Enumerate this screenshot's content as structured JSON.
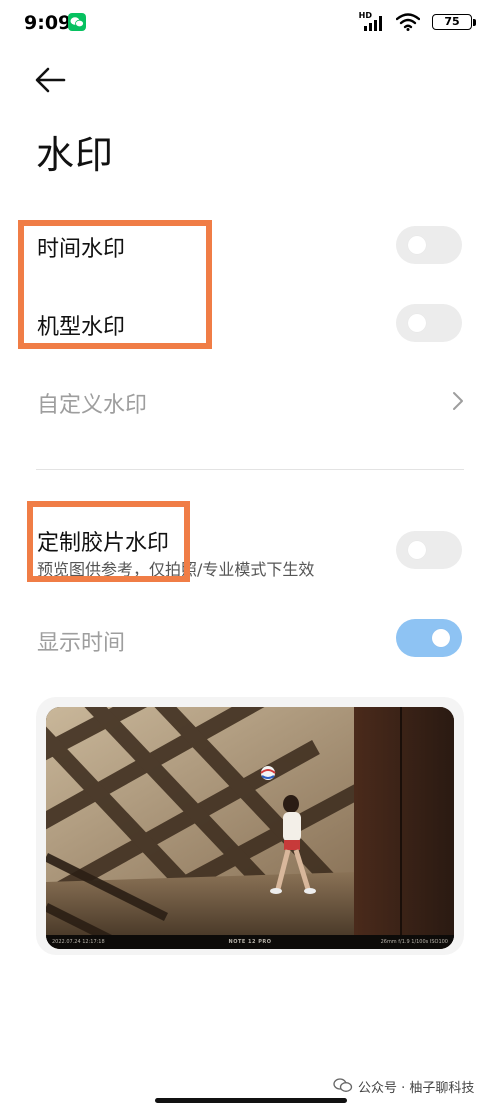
{
  "status_bar": {
    "time": "9:09",
    "network_badge": "HD",
    "battery": "75",
    "icons": [
      "wechat-icon",
      "signal-icon",
      "wifi-icon",
      "battery-icon"
    ]
  },
  "header": {
    "back_icon": "arrow-left-icon",
    "title": "水印"
  },
  "settings": {
    "time_watermark": {
      "label": "时间水印",
      "enabled": false
    },
    "model_watermark": {
      "label": "机型水印",
      "enabled": false
    },
    "custom_watermark": {
      "label": "自定义水印",
      "disabled": true,
      "icon": "chevron-right-icon"
    },
    "film_watermark": {
      "label": "定制胶片水印",
      "description": "预览图供参考，仅拍照/专业模式下生效",
      "enabled": false
    },
    "show_time": {
      "label": "显示时间",
      "enabled": true,
      "disabled": true
    }
  },
  "preview": {
    "date": "2022.07.24  12:17:18",
    "device": "NOTE 12 PRO",
    "specs": "26mm  f/1.9  1/100s  ISO100"
  },
  "footer": {
    "watermark_text": "公众号 · 柚子聊科技"
  },
  "colors": {
    "highlight": "#f07d46",
    "toggle_off": "#ececec",
    "toggle_on": "#8ec3f3",
    "wechat_green": "#07c160"
  }
}
